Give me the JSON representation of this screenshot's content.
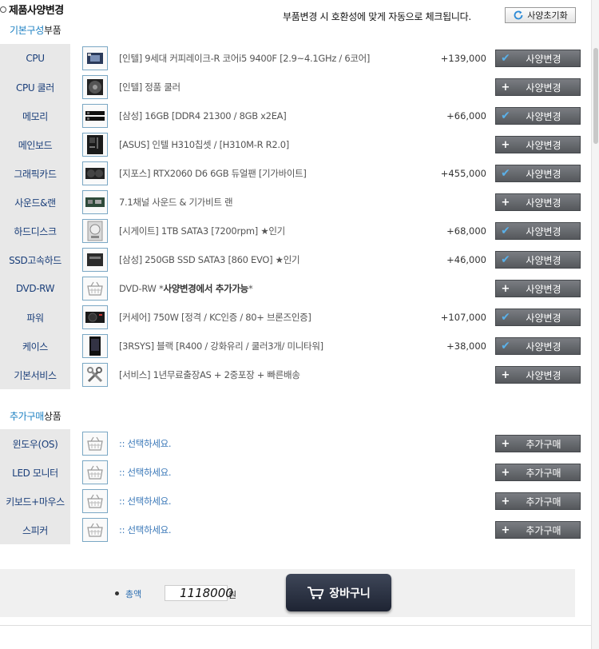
{
  "header": {
    "title": "제품사양변경",
    "notice": "부품변경 시 호환성에 맞게 자동으로 체크됩니다.",
    "reset_label": "사양초기화"
  },
  "basic": {
    "title_accent": "기본구성",
    "title_rest": "부품",
    "rows": [
      {
        "label": "CPU",
        "icon": "cpu-icon",
        "desc": "[인텔] 9세대 커피레이크-R 코어i5 9400F [2.9~4.1GHz / 6코어]",
        "price": "+139,000",
        "button": "사양변경",
        "selected": true
      },
      {
        "label": "CPU 쿨러",
        "icon": "cooler-icon",
        "desc": "[인텔] 정품 쿨러",
        "price": "",
        "button": "사양변경",
        "selected": false
      },
      {
        "label": "메모리",
        "icon": "memory-icon",
        "desc": "[삼성] 16GB [DDR4 21300 / 8GB x2EA]",
        "price": "+66,000",
        "button": "사양변경",
        "selected": true
      },
      {
        "label": "메인보드",
        "icon": "motherboard-icon",
        "desc": "[ASUS] 인텔 H310칩셋 / [H310M-R R2.0]",
        "price": "",
        "button": "사양변경",
        "selected": false
      },
      {
        "label": "그래픽카드",
        "icon": "gpu-icon",
        "desc": "[지포스] RTX2060 D6 6GB 듀얼팬 [기가바이트]",
        "price": "+455,000",
        "button": "사양변경",
        "selected": true
      },
      {
        "label": "사운드&랜",
        "icon": "sound-card-icon",
        "desc": "7.1채널 사운드 & 기가비트 랜",
        "price": "",
        "button": "사양변경",
        "selected": false
      },
      {
        "label": "하드디스크",
        "icon": "hdd-icon",
        "desc": "[시게이트] 1TB SATA3 [7200rpm] ★인기",
        "price": "+68,000",
        "button": "사양변경",
        "selected": true
      },
      {
        "label": "SSD고속하드",
        "icon": "ssd-icon",
        "desc": "[삼성] 250GB SSD SATA3 [860 EVO] ★인기",
        "price": "+46,000",
        "button": "사양변경",
        "selected": true
      },
      {
        "label": "DVD-RW",
        "icon": "basket-icon",
        "desc_prefix": "DVD-RW *",
        "desc_bold": "사양변경에서 추가가능",
        "desc_suffix": "*",
        "price": "",
        "button": "사양변경",
        "selected": false
      },
      {
        "label": "파워",
        "icon": "psu-icon",
        "desc": "[커세어] 750W [정격 / KC인증 / 80+ 브론즈인증]",
        "price": "+107,000",
        "button": "사양변경",
        "selected": true
      },
      {
        "label": "케이스",
        "icon": "case-icon",
        "desc": "[3RSYS] 블랙 [R400 / 강화유리 / 쿨러3개/ 미니타워]",
        "price": "+38,000",
        "button": "사양변경",
        "selected": true
      },
      {
        "label": "기본서비스",
        "icon": "tools-icon",
        "desc": "[서비스] 1년무료출장AS + 2중포장 + 빠른배송",
        "price": "",
        "button": "사양변경",
        "selected": false
      }
    ]
  },
  "extra": {
    "title_accent": "추가구매",
    "title_rest": "상품",
    "rows": [
      {
        "label": "윈도우(OS)",
        "icon": "basket-icon",
        "desc": ":: 선택하세요.",
        "button": "추가구매"
      },
      {
        "label": "LED 모니터",
        "icon": "basket-icon",
        "desc": ":: 선택하세요.",
        "button": "추가구매"
      },
      {
        "label": "키보드+마우스",
        "icon": "basket-icon",
        "desc": ":: 선택하세요.",
        "button": "추가구매"
      },
      {
        "label": "스피커",
        "icon": "basket-icon",
        "desc": ":: 선택하세요.",
        "button": "추가구매"
      }
    ]
  },
  "footer": {
    "total_label": "총액",
    "total_value": "1118000",
    "currency": "원",
    "cart_label": "장바구니"
  },
  "colors": {
    "accent": "#1a7fc2",
    "button_bg": "#65686c",
    "label_text": "#1b3f7a",
    "cart_bg": "#2a3142"
  }
}
